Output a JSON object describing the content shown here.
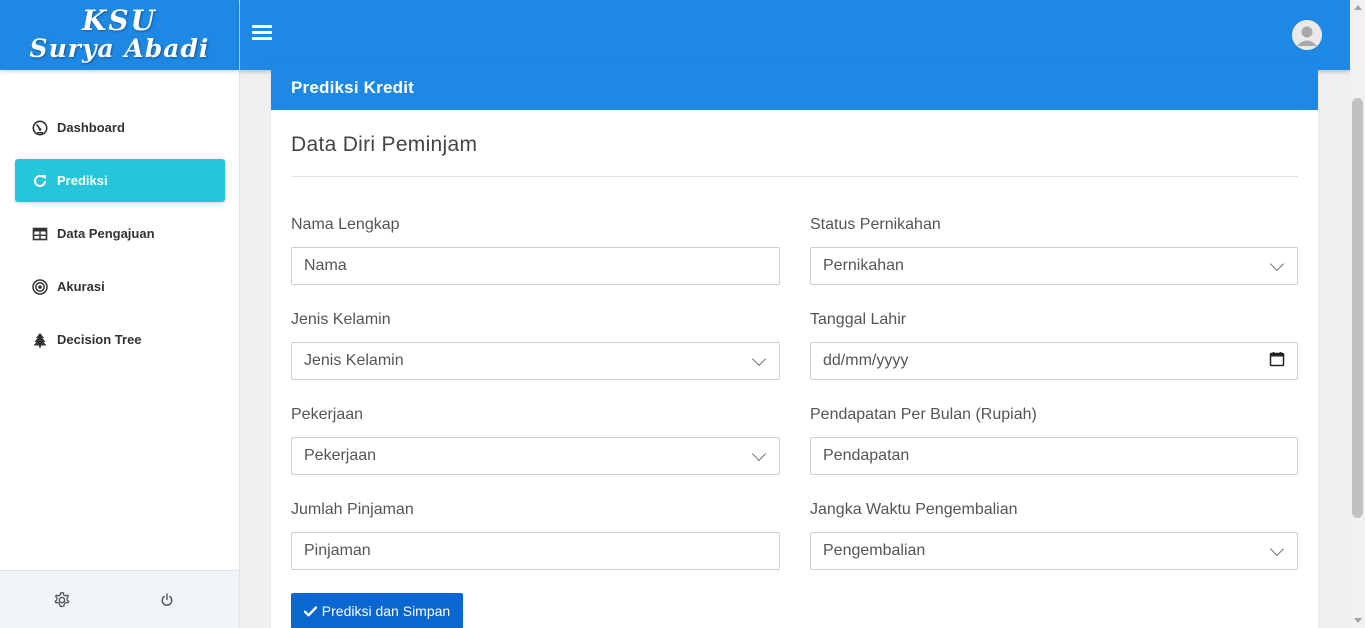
{
  "brand": {
    "line1": "KSU",
    "line2": "Surya Abadi"
  },
  "sidebar": {
    "items": [
      {
        "label": "Dashboard",
        "icon": "dashboard-gauge-icon"
      },
      {
        "label": "Prediksi",
        "icon": "refresh-icon",
        "active": true
      },
      {
        "label": "Data Pengajuan",
        "icon": "table-icon"
      },
      {
        "label": "Akurasi",
        "icon": "target-icon"
      },
      {
        "label": "Decision Tree",
        "icon": "tree-icon"
      }
    ],
    "footer_icons": [
      "gear-icon",
      "power-icon"
    ]
  },
  "topbar": {
    "menu_icon": "hamburger-icon",
    "avatar_icon": "user-avatar-icon"
  },
  "colors": {
    "primary": "#1e88e5",
    "active": "#26c6da",
    "button": "#0a67d0"
  },
  "card": {
    "header": "Prediksi Kredit",
    "section_title": "Data Diri Peminjam",
    "fields": {
      "nama": {
        "label": "Nama Lengkap",
        "placeholder": "Nama"
      },
      "status": {
        "label": "Status Pernikahan",
        "value": "Pernikahan"
      },
      "kelamin": {
        "label": "Jenis Kelamin",
        "value": "Jenis Kelamin"
      },
      "tanggal": {
        "label": "Tanggal Lahir",
        "placeholder": "dd/mm/yyyy"
      },
      "pekerjaan": {
        "label": "Pekerjaan",
        "value": "Pekerjaan"
      },
      "pendapatan": {
        "label": "Pendapatan Per Bulan (Rupiah)",
        "placeholder": "Pendapatan"
      },
      "pinjaman": {
        "label": "Jumlah Pinjaman",
        "placeholder": "Pinjaman"
      },
      "jangka": {
        "label": "Jangka Waktu Pengembalian",
        "value": "Pengembalian"
      }
    },
    "submit_label": "Prediksi dan Simpan"
  }
}
